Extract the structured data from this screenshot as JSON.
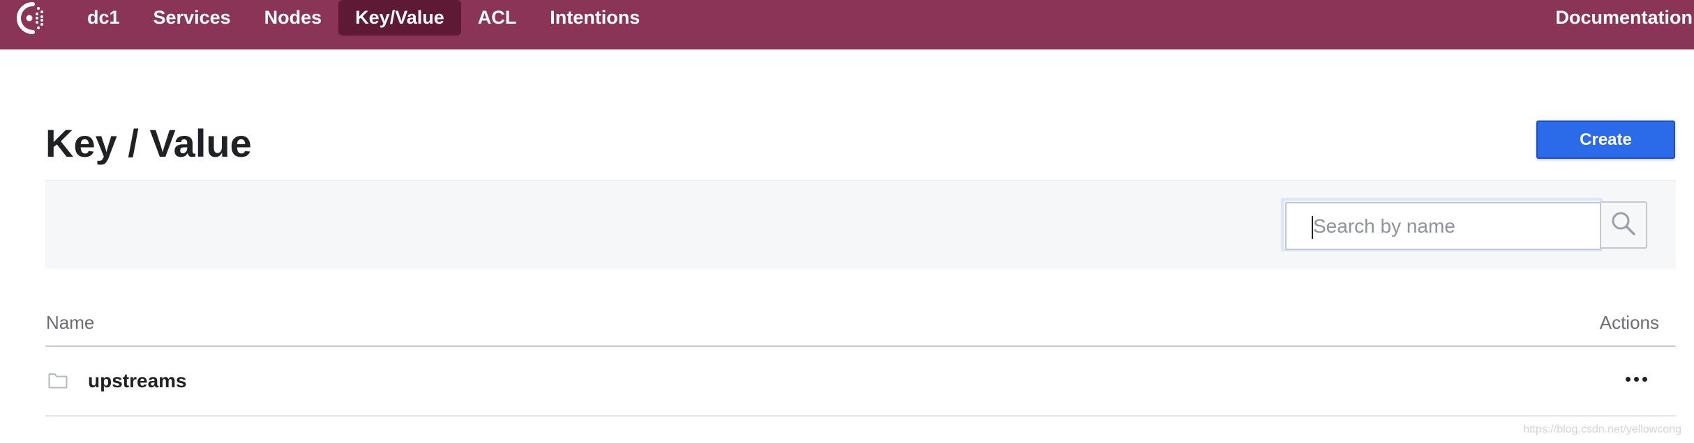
{
  "nav": {
    "logo_icon": "consul-logo-icon",
    "items": [
      {
        "label": "dc1",
        "active": false
      },
      {
        "label": "Services",
        "active": false
      },
      {
        "label": "Nodes",
        "active": false
      },
      {
        "label": "Key/Value",
        "active": true
      },
      {
        "label": "ACL",
        "active": false
      },
      {
        "label": "Intentions",
        "active": false
      }
    ],
    "documentation_label": "Documentation"
  },
  "page": {
    "title": "Key / Value",
    "create_label": "Create"
  },
  "filter": {
    "search_placeholder": "Search by name",
    "search_value": "",
    "search_icon": "search-icon"
  },
  "table": {
    "columns": [
      "Name",
      "Actions"
    ],
    "rows": [
      {
        "name": "upstreams",
        "type": "folder",
        "icon": "folder-icon",
        "actions_icon": "more-icon"
      }
    ]
  },
  "watermark": "https://blog.csdn.net/yellowcong",
  "colors": {
    "brand": "#8a3457",
    "nav_active": "#5e1a35",
    "primary_button": "#2b6ae8",
    "filter_bar": "#f6f7f9"
  }
}
